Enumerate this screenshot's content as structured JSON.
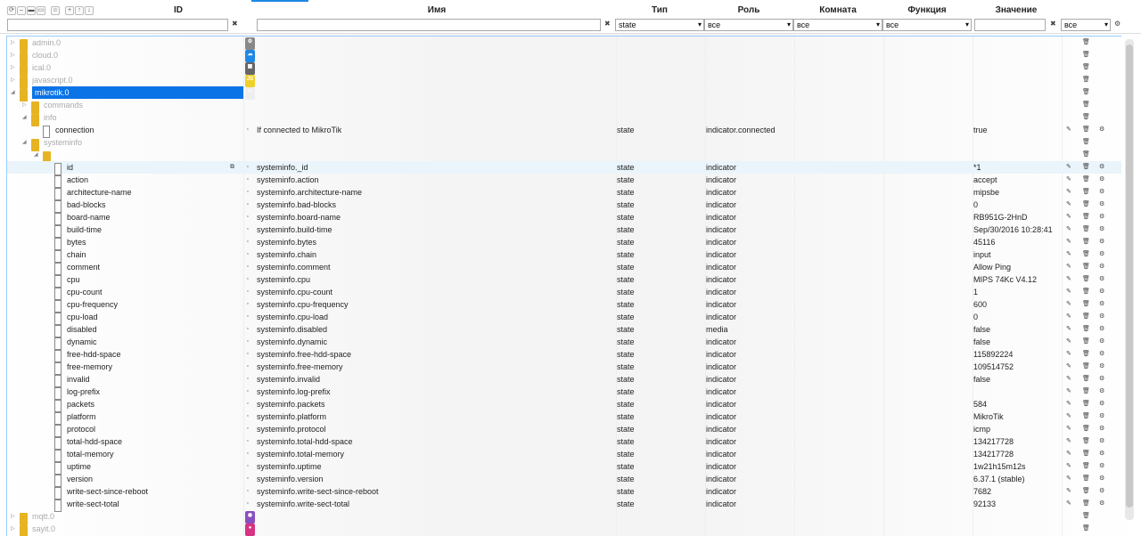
{
  "toolbar": {
    "buttons": [
      "refresh-icon",
      "collapse-icon",
      "folder-closed-icon",
      "folder-open-icon",
      "user-icon",
      "add-icon",
      "upload-icon",
      "download-icon"
    ]
  },
  "headers": {
    "id": "ID",
    "name": "Имя",
    "type": "Тип",
    "role": "Роль",
    "room": "Комната",
    "func": "Функция",
    "value": "Значение"
  },
  "filters": {
    "id": "",
    "name": "",
    "type": "state",
    "role": "все",
    "room": "все",
    "func": "все",
    "value": "",
    "extra": "все"
  },
  "rows": [
    {
      "lvl": 0,
      "caret": "▷",
      "kind": "fold",
      "id": "admin.0",
      "dim": true,
      "icon": "⚙",
      "iconbg": "#888"
    },
    {
      "lvl": 0,
      "caret": "▷",
      "kind": "fold",
      "id": "cloud.0",
      "dim": true,
      "icon": "☁",
      "iconbg": "#1e88e5"
    },
    {
      "lvl": 0,
      "caret": "▷",
      "kind": "fold",
      "id": "ical.0",
      "dim": true,
      "icon": "▦",
      "iconbg": "#666"
    },
    {
      "lvl": 0,
      "caret": "▷",
      "kind": "fold",
      "id": "javascript.0",
      "dim": true,
      "icon": "JS",
      "iconbg": "#f2d02a"
    },
    {
      "lvl": 0,
      "caret": "◢",
      "kind": "fold",
      "id": "mikrotik.0",
      "selected": true,
      "icon": "≈",
      "iconbg": "#eee"
    },
    {
      "lvl": 1,
      "caret": "▷",
      "kind": "fold",
      "id": "commands",
      "dim": true
    },
    {
      "lvl": 1,
      "caret": "◢",
      "kind": "fold",
      "id": "info",
      "dim": true
    },
    {
      "lvl": 2,
      "kind": "doc",
      "id": "connection",
      "name": "If connected to MikroTik",
      "type": "state",
      "role": "indicator.connected",
      "value": "true",
      "acts": true
    },
    {
      "lvl": 1,
      "caret": "◢",
      "kind": "fold",
      "id": "systeminfo",
      "dim": true
    },
    {
      "lvl": 2,
      "caret": "◢",
      "kind": "fold",
      "id": ""
    },
    {
      "lvl": 3,
      "kind": "doc",
      "id": "id",
      "name": "systeminfo._id",
      "type": "state",
      "role": "indicator",
      "value": "*1",
      "acts": true,
      "hi": true
    },
    {
      "lvl": 3,
      "kind": "doc",
      "id": "action",
      "name": "systeminfo.action",
      "type": "state",
      "role": "indicator",
      "value": "accept",
      "acts": true
    },
    {
      "lvl": 3,
      "kind": "doc",
      "id": "architecture-name",
      "name": "systeminfo.architecture-name",
      "type": "state",
      "role": "indicator",
      "value": "mipsbe",
      "acts": true
    },
    {
      "lvl": 3,
      "kind": "doc",
      "id": "bad-blocks",
      "name": "systeminfo.bad-blocks",
      "type": "state",
      "role": "indicator",
      "value": "0",
      "acts": true
    },
    {
      "lvl": 3,
      "kind": "doc",
      "id": "board-name",
      "name": "systeminfo.board-name",
      "type": "state",
      "role": "indicator",
      "value": "RB951G-2HnD",
      "acts": true
    },
    {
      "lvl": 3,
      "kind": "doc",
      "id": "build-time",
      "name": "systeminfo.build-time",
      "type": "state",
      "role": "indicator",
      "value": "Sep/30/2016 10:28:41",
      "acts": true
    },
    {
      "lvl": 3,
      "kind": "doc",
      "id": "bytes",
      "name": "systeminfo.bytes",
      "type": "state",
      "role": "indicator",
      "value": "45116",
      "acts": true
    },
    {
      "lvl": 3,
      "kind": "doc",
      "id": "chain",
      "name": "systeminfo.chain",
      "type": "state",
      "role": "indicator",
      "value": "input",
      "acts": true
    },
    {
      "lvl": 3,
      "kind": "doc",
      "id": "comment",
      "name": "systeminfo.comment",
      "type": "state",
      "role": "indicator",
      "value": "Allow Ping",
      "acts": true
    },
    {
      "lvl": 3,
      "kind": "doc",
      "id": "cpu",
      "name": "systeminfo.cpu",
      "type": "state",
      "role": "indicator",
      "value": "MIPS 74Kc V4.12",
      "acts": true
    },
    {
      "lvl": 3,
      "kind": "doc",
      "id": "cpu-count",
      "name": "systeminfo.cpu-count",
      "type": "state",
      "role": "indicator",
      "value": "1",
      "acts": true
    },
    {
      "lvl": 3,
      "kind": "doc",
      "id": "cpu-frequency",
      "name": "systeminfo.cpu-frequency",
      "type": "state",
      "role": "indicator",
      "value": "600",
      "acts": true
    },
    {
      "lvl": 3,
      "kind": "doc",
      "id": "cpu-load",
      "name": "systeminfo.cpu-load",
      "type": "state",
      "role": "indicator",
      "value": "0",
      "acts": true
    },
    {
      "lvl": 3,
      "kind": "doc",
      "id": "disabled",
      "name": "systeminfo.disabled",
      "type": "state",
      "role": "media",
      "value": "false",
      "acts": true
    },
    {
      "lvl": 3,
      "kind": "doc",
      "id": "dynamic",
      "name": "systeminfo.dynamic",
      "type": "state",
      "role": "indicator",
      "value": "false",
      "acts": true
    },
    {
      "lvl": 3,
      "kind": "doc",
      "id": "free-hdd-space",
      "name": "systeminfo.free-hdd-space",
      "type": "state",
      "role": "indicator",
      "value": "115892224",
      "acts": true
    },
    {
      "lvl": 3,
      "kind": "doc",
      "id": "free-memory",
      "name": "systeminfo.free-memory",
      "type": "state",
      "role": "indicator",
      "value": "109514752",
      "acts": true
    },
    {
      "lvl": 3,
      "kind": "doc",
      "id": "invalid",
      "name": "systeminfo.invalid",
      "type": "state",
      "role": "indicator",
      "value": "false",
      "acts": true
    },
    {
      "lvl": 3,
      "kind": "doc",
      "id": "log-prefix",
      "name": "systeminfo.log-prefix",
      "type": "state",
      "role": "indicator",
      "value": "",
      "acts": true
    },
    {
      "lvl": 3,
      "kind": "doc",
      "id": "packets",
      "name": "systeminfo.packets",
      "type": "state",
      "role": "indicator",
      "value": "584",
      "acts": true
    },
    {
      "lvl": 3,
      "kind": "doc",
      "id": "platform",
      "name": "systeminfo.platform",
      "type": "state",
      "role": "indicator",
      "value": "MikroTik",
      "acts": true
    },
    {
      "lvl": 3,
      "kind": "doc",
      "id": "protocol",
      "name": "systeminfo.protocol",
      "type": "state",
      "role": "indicator",
      "value": "icmp",
      "acts": true
    },
    {
      "lvl": 3,
      "kind": "doc",
      "id": "total-hdd-space",
      "name": "systeminfo.total-hdd-space",
      "type": "state",
      "role": "indicator",
      "value": "134217728",
      "acts": true
    },
    {
      "lvl": 3,
      "kind": "doc",
      "id": "total-memory",
      "name": "systeminfo.total-memory",
      "type": "state",
      "role": "indicator",
      "value": "134217728",
      "acts": true
    },
    {
      "lvl": 3,
      "kind": "doc",
      "id": "uptime",
      "name": "systeminfo.uptime",
      "type": "state",
      "role": "indicator",
      "value": "1w21h15m12s",
      "acts": true
    },
    {
      "lvl": 3,
      "kind": "doc",
      "id": "version",
      "name": "systeminfo.version",
      "type": "state",
      "role": "indicator",
      "value": "6.37.1 (stable)",
      "acts": true
    },
    {
      "lvl": 3,
      "kind": "doc",
      "id": "write-sect-since-reboot",
      "name": "systeminfo.write-sect-since-reboot",
      "type": "state",
      "role": "indicator",
      "value": "7682",
      "acts": true
    },
    {
      "lvl": 3,
      "kind": "doc",
      "id": "write-sect-total",
      "name": "systeminfo.write-sect-total",
      "type": "state",
      "role": "indicator",
      "value": "92133",
      "acts": true
    },
    {
      "lvl": 0,
      "caret": "▷",
      "kind": "fold",
      "id": "mqtt.0",
      "dim": true,
      "icon": "◉",
      "iconbg": "#8a4fbf"
    },
    {
      "lvl": 0,
      "caret": "▷",
      "kind": "fold",
      "id": "sayit.0",
      "dim": true,
      "icon": "●",
      "iconbg": "#d63384"
    }
  ]
}
